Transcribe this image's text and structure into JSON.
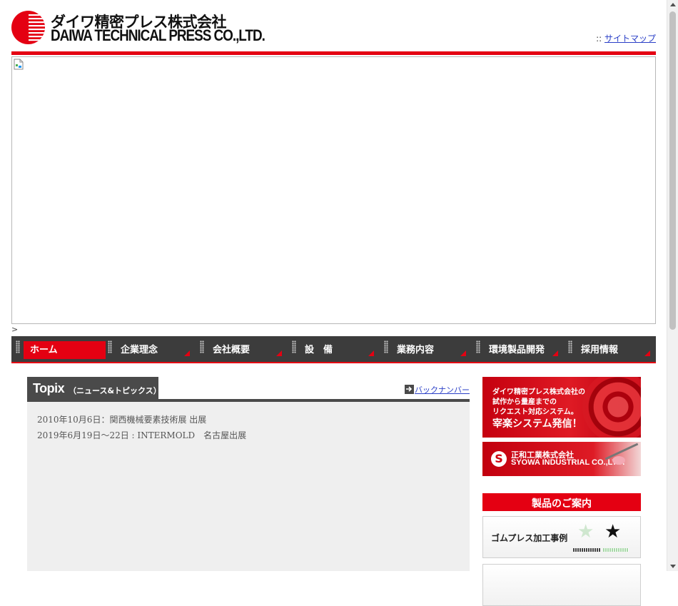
{
  "header": {
    "logo_jp": "ダイワ精密プレス株式会社",
    "logo_en": "DAIWA TECHNICAL PRESS CO.,LTD.",
    "sitemap_prefix": "::",
    "sitemap_link": "サイトマップ"
  },
  "stray_char": ">",
  "nav": {
    "items": [
      {
        "label": "ホーム",
        "active": true
      },
      {
        "label": "企業理念"
      },
      {
        "label": "会社概要"
      },
      {
        "label": "設　備"
      },
      {
        "label": "業務内容"
      },
      {
        "label": "環境製品開発"
      },
      {
        "label": "採用情報"
      }
    ]
  },
  "topix": {
    "title": "Topix",
    "subtitle": "（ニュース&トピックス）",
    "back_number": "バックナンバー",
    "news": [
      "2010年10月6日：関西機械要素技術展 出展",
      "2019年6月19日～22日 : INTERMOLD　名古屋出展"
    ]
  },
  "side": {
    "banner1_lines": [
      "ダイワ精密プレス株式会社の",
      "試作から量産までの",
      "リクエスト対応システム。",
      "宰楽システム発信！"
    ],
    "banner2_jp": "正和工業株式会社",
    "banner2_en": "SYOWA INDUSTRIAL CO.,LTD.",
    "products_heading": "製品のご案内",
    "product_cards": [
      {
        "label": "ゴムプレス加工事例"
      }
    ]
  },
  "colors": {
    "brand_red": "#e40012",
    "nav_bg": "#3c3c3c",
    "link_blue": "#2a3fc7"
  }
}
